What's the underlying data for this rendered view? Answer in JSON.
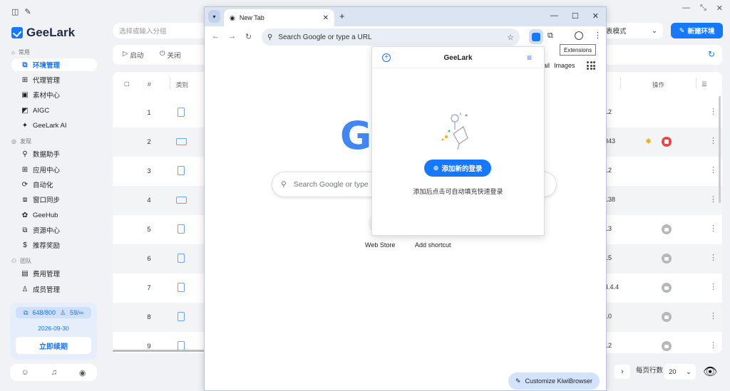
{
  "sidebar": {
    "logo_text": "GeeLark",
    "sections": [
      {
        "label": "常用"
      },
      {
        "label": "发现"
      },
      {
        "label": "团队"
      }
    ],
    "items": [
      {
        "label": "环境管理",
        "icon": "environment-icon"
      },
      {
        "label": "代理管理",
        "icon": "proxy-icon"
      },
      {
        "label": "素材中心",
        "icon": "materials-icon"
      },
      {
        "label": "AIGC",
        "icon": "aigc-icon"
      },
      {
        "label": "GeeLark AI",
        "icon": "ai-icon"
      },
      {
        "label": "数据助手",
        "icon": "data-icon"
      },
      {
        "label": "应用中心",
        "icon": "apps-icon"
      },
      {
        "label": "自动化",
        "icon": "automation-icon"
      },
      {
        "label": "窗口同步",
        "icon": "sync-icon"
      },
      {
        "label": "GeeHub",
        "icon": "geehub-icon"
      },
      {
        "label": "资源中心",
        "icon": "resources-icon"
      },
      {
        "label": "推荐奖励",
        "icon": "reward-icon"
      },
      {
        "label": "费用管理",
        "icon": "billing-icon"
      },
      {
        "label": "成员管理",
        "icon": "members-icon"
      }
    ],
    "quota": {
      "envs": "648/800",
      "members": "59/∞",
      "expiry": "2026-09-30",
      "renew_label": "立即续期"
    }
  },
  "main": {
    "group_placeholder": "选择或输入分组",
    "mode_label": "表模式",
    "new_env_label": "新建环境",
    "toolbar": {
      "start_label": "启动",
      "close_label": "关闭"
    },
    "table": {
      "headers": {
        "num": "#",
        "type": "类别",
        "actions": "操作"
      },
      "rows": [
        {
          "num": "1",
          "device": "phone",
          "tail": "12",
          "action": ""
        },
        {
          "num": "2",
          "device": "laptop",
          "tail": "343",
          "action": "running"
        },
        {
          "num": "3",
          "device": "phone",
          "tail": "12",
          "action": ""
        },
        {
          "num": "4",
          "device": "laptop",
          "tail": "138",
          "action": ""
        },
        {
          "num": "5",
          "device": "phone",
          "tail": "13",
          "action": "locked"
        },
        {
          "num": "6",
          "device": "phone",
          "tail": "15",
          "action": "locked"
        },
        {
          "num": "7",
          "device": "phone",
          "tail": "4.4.4",
          "action": "locked"
        },
        {
          "num": "8",
          "device": "phone",
          "tail": "10",
          "action": "locked"
        },
        {
          "num": "9",
          "device": "phone",
          "tail": "12",
          "action": "locked"
        }
      ]
    },
    "pagination": {
      "rows_per_page_label": "每页行数",
      "page_size": "20"
    }
  },
  "browser": {
    "tab_title": "New Tab",
    "omnibox_placeholder": "Search Google or type a URL",
    "tooltip": "Extensions",
    "top_links": {
      "gmail": "ail",
      "images": "Images"
    },
    "google_logo_fragment": "G",
    "search_placeholder": "Search Google or type",
    "shortcuts": [
      "Web Store",
      "Add shortcut"
    ],
    "customize_label": "Customize KiwiBrowser"
  },
  "popup": {
    "title": "GeeLark",
    "add_login_label": "添加新的登录",
    "hint": "添加后点击可自动填充快速登录"
  },
  "colors": {
    "accent": "#1677ff",
    "danger": "#ef4444",
    "warning": "#f5b301"
  }
}
